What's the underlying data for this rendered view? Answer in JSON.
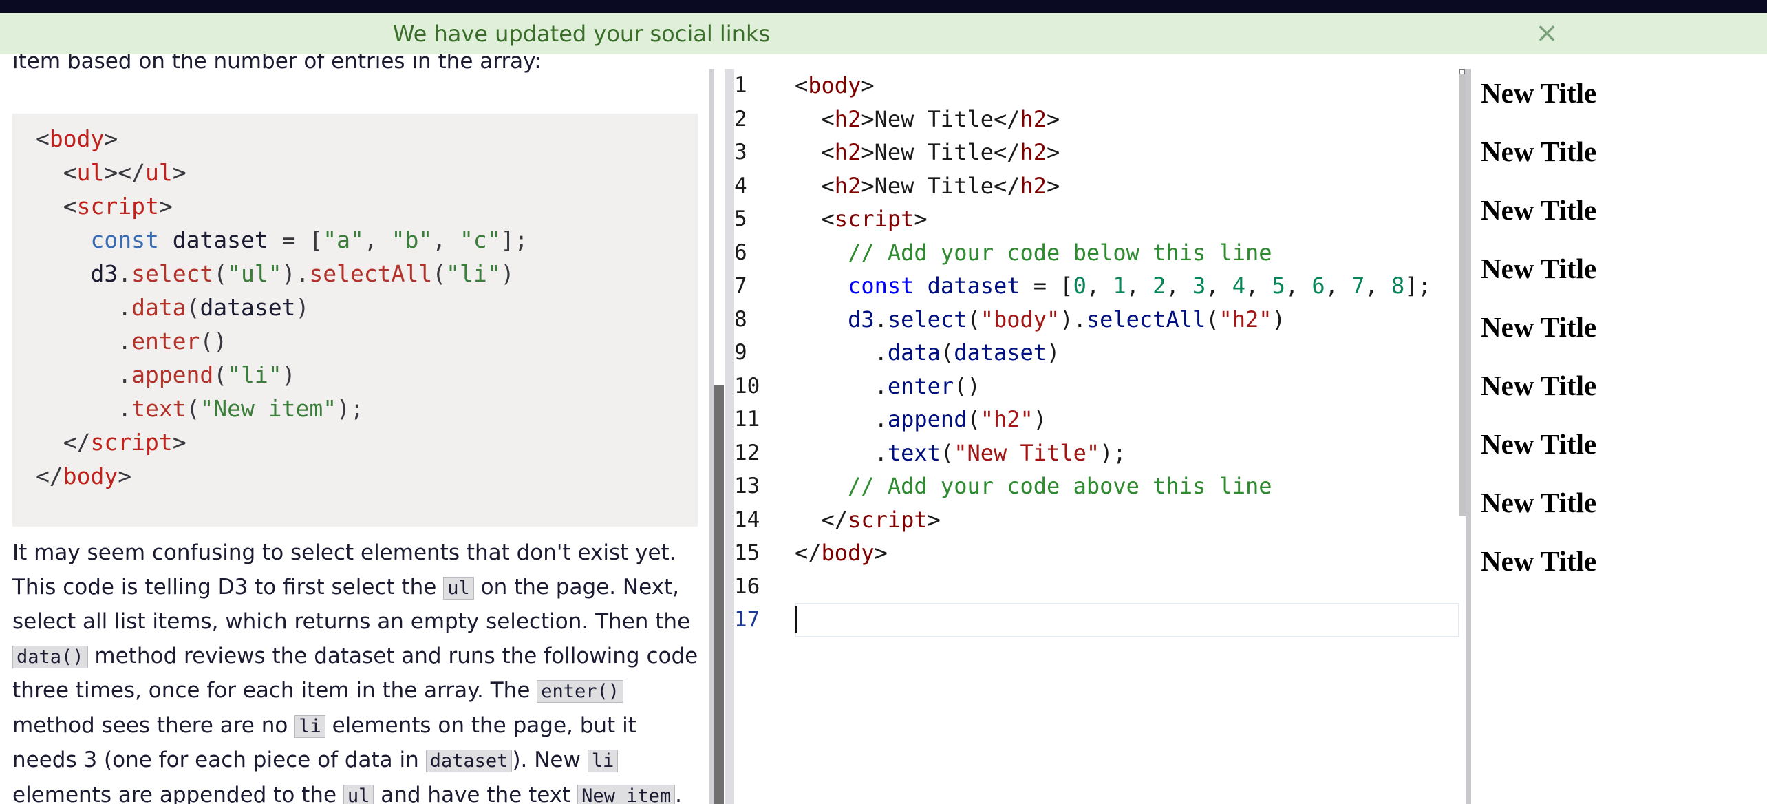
{
  "flash": {
    "message": "We have updated your social links",
    "close": "×"
  },
  "instructions": {
    "intro": "item based on the number of entries in the array:",
    "example_code": [
      [
        {
          "t": "<",
          "c": "pn"
        },
        {
          "t": "body",
          "c": "tag"
        },
        {
          "t": ">",
          "c": "pn"
        }
      ],
      [
        {
          "t": "  <",
          "c": "pn"
        },
        {
          "t": "ul",
          "c": "tag"
        },
        {
          "t": "></",
          "c": "pn"
        },
        {
          "t": "ul",
          "c": "tag"
        },
        {
          "t": ">",
          "c": "pn"
        }
      ],
      [
        {
          "t": "  <",
          "c": "pn"
        },
        {
          "t": "script",
          "c": "tag"
        },
        {
          "t": ">",
          "c": "pn"
        }
      ],
      [
        {
          "t": "    ",
          "c": "id"
        },
        {
          "t": "const",
          "c": "kw"
        },
        {
          "t": " dataset ",
          "c": "id"
        },
        {
          "t": "= [",
          "c": "pn"
        },
        {
          "t": "\"a\"",
          "c": "st"
        },
        {
          "t": ", ",
          "c": "pn"
        },
        {
          "t": "\"b\"",
          "c": "st"
        },
        {
          "t": ", ",
          "c": "pn"
        },
        {
          "t": "\"c\"",
          "c": "st"
        },
        {
          "t": "];",
          "c": "pn"
        }
      ],
      [
        {
          "t": "    d3",
          "c": "id"
        },
        {
          "t": ".",
          "c": "pn"
        },
        {
          "t": "select",
          "c": "fn"
        },
        {
          "t": "(",
          "c": "pn"
        },
        {
          "t": "\"ul\"",
          "c": "st"
        },
        {
          "t": ").",
          "c": "pn"
        },
        {
          "t": "selectAll",
          "c": "fn"
        },
        {
          "t": "(",
          "c": "pn"
        },
        {
          "t": "\"li\"",
          "c": "st"
        },
        {
          "t": ")",
          "c": "pn"
        }
      ],
      [
        {
          "t": "      .",
          "c": "pn"
        },
        {
          "t": "data",
          "c": "fn"
        },
        {
          "t": "(",
          "c": "pn"
        },
        {
          "t": "dataset",
          "c": "id"
        },
        {
          "t": ")",
          "c": "pn"
        }
      ],
      [
        {
          "t": "      .",
          "c": "pn"
        },
        {
          "t": "enter",
          "c": "fn"
        },
        {
          "t": "()",
          "c": "pn"
        }
      ],
      [
        {
          "t": "      .",
          "c": "pn"
        },
        {
          "t": "append",
          "c": "fn"
        },
        {
          "t": "(",
          "c": "pn"
        },
        {
          "t": "\"li\"",
          "c": "st"
        },
        {
          "t": ")",
          "c": "pn"
        }
      ],
      [
        {
          "t": "      .",
          "c": "pn"
        },
        {
          "t": "text",
          "c": "fn"
        },
        {
          "t": "(",
          "c": "pn"
        },
        {
          "t": "\"New item\"",
          "c": "st"
        },
        {
          "t": ");",
          "c": "pn"
        }
      ],
      [
        {
          "t": "  </",
          "c": "pn"
        },
        {
          "t": "script",
          "c": "tag"
        },
        {
          "t": ">",
          "c": "pn"
        }
      ],
      [
        {
          "t": "</",
          "c": "pn"
        },
        {
          "t": "body",
          "c": "tag"
        },
        {
          "t": ">",
          "c": "pn"
        }
      ]
    ],
    "paragraph": [
      {
        "t": "It may seem confusing to select elements that don't exist yet. This code is telling D3 to first select the "
      },
      {
        "t": "ul",
        "code": true
      },
      {
        "t": " on the page. Next, select all list items, which returns an empty selection. Then the "
      },
      {
        "t": "data()",
        "code": true
      },
      {
        "t": " method reviews the dataset and runs the following code three times, once for each item in the array. The "
      },
      {
        "t": "enter()",
        "code": true
      },
      {
        "t": " method sees there are no "
      },
      {
        "t": "li",
        "code": true
      },
      {
        "t": " elements on the page, but it needs 3 (one for each piece of data in "
      },
      {
        "t": "dataset",
        "code": true
      },
      {
        "t": "). New "
      },
      {
        "t": "li",
        "code": true
      },
      {
        "t": " elements are appended to the "
      },
      {
        "t": "ul",
        "code": true
      },
      {
        "t": " and have the text "
      },
      {
        "t": "New item",
        "code": true
      },
      {
        "t": "."
      }
    ]
  },
  "editor": {
    "line_numbers": [
      "1",
      "2",
      "3",
      "4",
      "5",
      "6",
      "7",
      "8",
      "9",
      "10",
      "11",
      "12",
      "13",
      "14",
      "15",
      "16",
      "17"
    ],
    "active_line": "17",
    "lines": [
      [
        {
          "t": "<",
          "c": "pn"
        },
        {
          "t": "body",
          "c": "tag"
        },
        {
          "t": ">",
          "c": "pn"
        }
      ],
      [
        {
          "t": "  <",
          "c": "pn"
        },
        {
          "t": "h2",
          "c": "tag"
        },
        {
          "t": ">New Title</",
          "c": "pn"
        },
        {
          "t": "h2",
          "c": "tag"
        },
        {
          "t": ">",
          "c": "pn"
        }
      ],
      [
        {
          "t": "  <",
          "c": "pn"
        },
        {
          "t": "h2",
          "c": "tag"
        },
        {
          "t": ">New Title</",
          "c": "pn"
        },
        {
          "t": "h2",
          "c": "tag"
        },
        {
          "t": ">",
          "c": "pn"
        }
      ],
      [
        {
          "t": "  <",
          "c": "pn"
        },
        {
          "t": "h2",
          "c": "tag"
        },
        {
          "t": ">New Title</",
          "c": "pn"
        },
        {
          "t": "h2",
          "c": "tag"
        },
        {
          "t": ">",
          "c": "pn"
        }
      ],
      [
        {
          "t": "  <",
          "c": "pn"
        },
        {
          "t": "script",
          "c": "tag"
        },
        {
          "t": ">",
          "c": "pn"
        }
      ],
      [
        {
          "t": "    // Add your code below this line",
          "c": "cm"
        }
      ],
      [
        {
          "t": "    ",
          "c": "pn"
        },
        {
          "t": "const",
          "c": "kw"
        },
        {
          "t": " ",
          "c": "pn"
        },
        {
          "t": "dataset",
          "c": "id"
        },
        {
          "t": " = [",
          "c": "pn"
        },
        {
          "t": "0",
          "c": "nm"
        },
        {
          "t": ", ",
          "c": "pn"
        },
        {
          "t": "1",
          "c": "nm"
        },
        {
          "t": ", ",
          "c": "pn"
        },
        {
          "t": "2",
          "c": "nm"
        },
        {
          "t": ", ",
          "c": "pn"
        },
        {
          "t": "3",
          "c": "nm"
        },
        {
          "t": ", ",
          "c": "pn"
        },
        {
          "t": "4",
          "c": "nm"
        },
        {
          "t": ", ",
          "c": "pn"
        },
        {
          "t": "5",
          "c": "nm"
        },
        {
          "t": ", ",
          "c": "pn"
        },
        {
          "t": "6",
          "c": "nm"
        },
        {
          "t": ", ",
          "c": "pn"
        },
        {
          "t": "7",
          "c": "nm"
        },
        {
          "t": ", ",
          "c": "pn"
        },
        {
          "t": "8",
          "c": "nm"
        },
        {
          "t": "];",
          "c": "pn"
        }
      ],
      [
        {
          "t": "    ",
          "c": "pn"
        },
        {
          "t": "d3",
          "c": "id"
        },
        {
          "t": ".",
          "c": "pn"
        },
        {
          "t": "select",
          "c": "id"
        },
        {
          "t": "(",
          "c": "pn"
        },
        {
          "t": "\"body\"",
          "c": "st"
        },
        {
          "t": ").",
          "c": "pn"
        },
        {
          "t": "selectAll",
          "c": "id"
        },
        {
          "t": "(",
          "c": "pn"
        },
        {
          "t": "\"h2\"",
          "c": "st"
        },
        {
          "t": ")",
          "c": "pn"
        }
      ],
      [
        {
          "t": "      .",
          "c": "pn"
        },
        {
          "t": "data",
          "c": "id"
        },
        {
          "t": "(",
          "c": "pn"
        },
        {
          "t": "dataset",
          "c": "id"
        },
        {
          "t": ")",
          "c": "pn"
        }
      ],
      [
        {
          "t": "      .",
          "c": "pn"
        },
        {
          "t": "enter",
          "c": "id"
        },
        {
          "t": "()",
          "c": "pn"
        }
      ],
      [
        {
          "t": "      .",
          "c": "pn"
        },
        {
          "t": "append",
          "c": "id"
        },
        {
          "t": "(",
          "c": "pn"
        },
        {
          "t": "\"h2\"",
          "c": "st"
        },
        {
          "t": ")",
          "c": "pn"
        }
      ],
      [
        {
          "t": "      .",
          "c": "pn"
        },
        {
          "t": "text",
          "c": "id"
        },
        {
          "t": "(",
          "c": "pn"
        },
        {
          "t": "\"New Title\"",
          "c": "st"
        },
        {
          "t": ");",
          "c": "pn"
        }
      ],
      [
        {
          "t": "    // Add your code above this line",
          "c": "cm"
        }
      ],
      [
        {
          "t": "  </",
          "c": "pn"
        },
        {
          "t": "script",
          "c": "tag"
        },
        {
          "t": ">",
          "c": "pn"
        }
      ],
      [
        {
          "t": "</",
          "c": "pn"
        },
        {
          "t": "body",
          "c": "tag"
        },
        {
          "t": ">",
          "c": "pn"
        }
      ],
      [],
      []
    ]
  },
  "preview": {
    "headings": [
      "New Title",
      "New Title",
      "New Title",
      "New Title",
      "New Title",
      "New Title",
      "New Title",
      "New Title",
      "New Title"
    ]
  }
}
